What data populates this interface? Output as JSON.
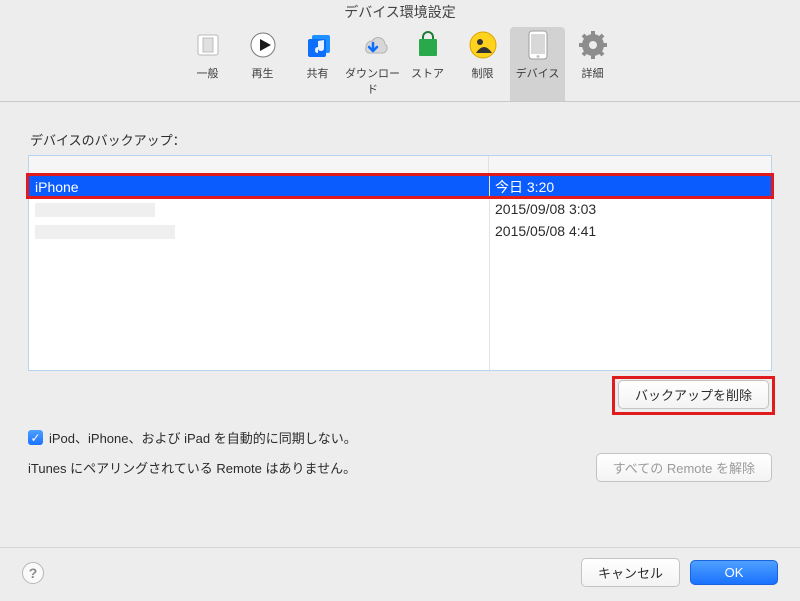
{
  "window": {
    "title": "デバイス環境設定"
  },
  "toolbar": {
    "items": [
      {
        "label": "一般"
      },
      {
        "label": "再生"
      },
      {
        "label": "共有"
      },
      {
        "label": "ダウンロード"
      },
      {
        "label": "ストア"
      },
      {
        "label": "制限"
      },
      {
        "label": "デバイス"
      },
      {
        "label": "詳細"
      }
    ],
    "selected_index": 6
  },
  "main": {
    "section_label": "デバイスのバックアップ：",
    "rows": [
      {
        "name": "iPhone",
        "date": "今日 3:20",
        "selected": true
      },
      {
        "name": "",
        "date": "2015/09/08 3:03",
        "selected": false
      },
      {
        "name": "",
        "date": "2015/05/08 4:41",
        "selected": false
      }
    ],
    "delete_label": "バックアップを削除",
    "sync_checkbox": {
      "checked": true,
      "label": "iPod、iPhone、および iPad を自動的に同期しない。"
    },
    "remote_text": "iTunes にペアリングされている Remote はありません。",
    "remote_button": "すべての Remote を解除"
  },
  "footer": {
    "cancel": "キャンセル",
    "ok": "OK"
  }
}
